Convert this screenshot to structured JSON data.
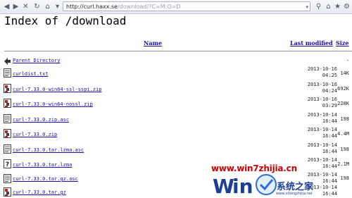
{
  "browser": {
    "address_host": "http://curl.haxx.se",
    "address_path": "/download/?C=M;O=D"
  },
  "page": {
    "title": "Index of /download",
    "columns": {
      "name": "Name",
      "modified": "Last modified",
      "size": "Size"
    }
  },
  "rows": [
    {
      "name": "Parent Directory",
      "date": "",
      "size": "-",
      "icon": "back-arrow-icon"
    },
    {
      "name": "curldist.txt",
      "date": "2013-10-16\n04:25",
      "size": "14K",
      "icon": "text-file-icon"
    },
    {
      "name": "curl-7.33.0-win64-ssl-sspi.zip",
      "date": "2013-10-16\n04:24",
      "size": "692K",
      "icon": "archive-file-icon"
    },
    {
      "name": "curl-7.33.0-win64-nossl.zip",
      "date": "2013-10-16\n03:29",
      "size": "228K",
      "icon": "archive-file-icon"
    },
    {
      "name": "curl-7.33.0.zip.asc",
      "date": "2013-10-14\n16:44",
      "size": "198",
      "icon": "text-file-icon"
    },
    {
      "name": "curl-7.33.0.zip",
      "date": "2013-10-14\n16:44",
      "size": "4.4M",
      "icon": "archive-file-icon"
    },
    {
      "name": "curl-7.33.0.tar.lzma.asc",
      "date": "2013-10-14\n16:44",
      "size": "198",
      "icon": "text-file-icon"
    },
    {
      "name": "curl-7.33.0.tar.lzma",
      "date": "2013-10-14\n16:44",
      "size": "2.1M",
      "icon": "unknown-file-icon"
    },
    {
      "name": "curl-7.33.0.tar.gz.asc",
      "date": "2013-10-14\n16:44",
      "size": "198",
      "icon": "text-file-icon"
    },
    {
      "name": "curl-7.33.0.tar.gz",
      "date": "2013-10-14\n16:44",
      "size": "",
      "icon": "archive-file-icon"
    }
  ],
  "watermark": {
    "url": "www.win7zhijia.cn",
    "brand": "系统之家",
    "site": "www.xitongzhijia.net"
  },
  "colors": {
    "link": "#1a0dab",
    "watermark_red": "#cc0000",
    "watermark_blue": "#1c3f96"
  }
}
